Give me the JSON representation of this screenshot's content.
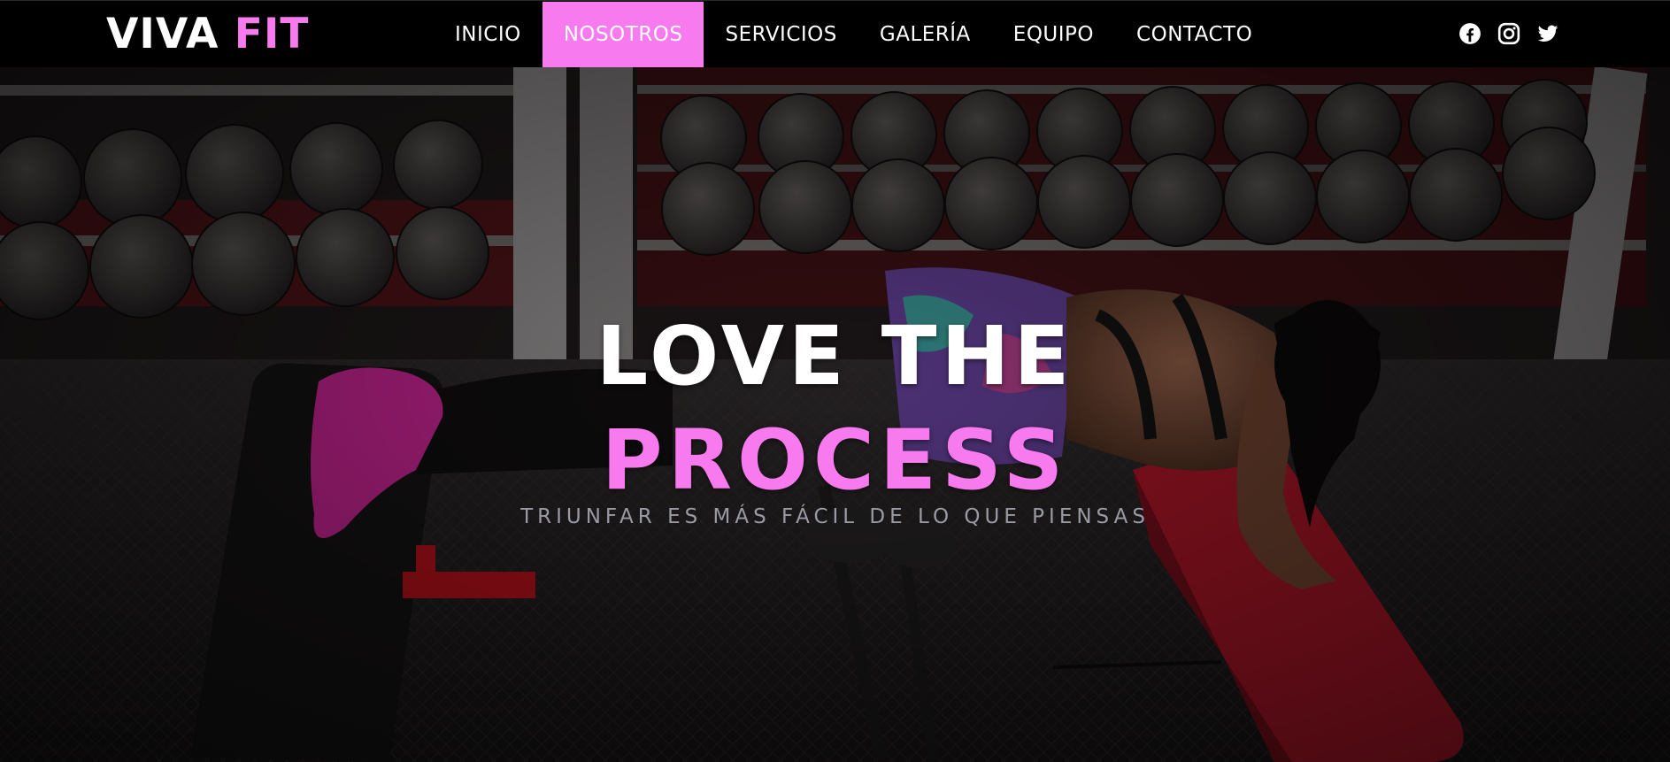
{
  "brand": {
    "name_part1": "VIVA",
    "name_part2": "FIT"
  },
  "nav": {
    "items": [
      {
        "label": "INICIO",
        "active": false
      },
      {
        "label": "NOSOTROS",
        "active": true
      },
      {
        "label": "SERVICIOS",
        "active": false
      },
      {
        "label": "GALERÍA",
        "active": false
      },
      {
        "label": "EQUIPO",
        "active": false
      },
      {
        "label": "CONTACTO",
        "active": false
      }
    ]
  },
  "social": {
    "icons": [
      "facebook-icon",
      "instagram-icon",
      "twitter-icon"
    ]
  },
  "hero": {
    "headline_line1": "LOVE THE",
    "headline_line2": "PROCESS",
    "tagline": "TRIUNFAR ES MÁS FÁCIL DE LO QUE PIENSAS",
    "background": "gym-dumbbell-rack-woman-decline-pushup-photo"
  },
  "colors": {
    "accent": "#f77bee",
    "nav_bg": "#000000",
    "text": "#ffffff",
    "tagline": "#9a9aa4"
  }
}
